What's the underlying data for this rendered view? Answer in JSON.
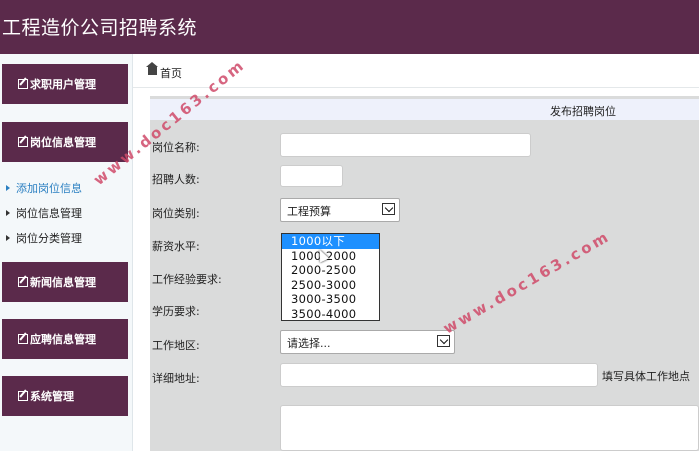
{
  "app": {
    "title": "工程造价公司招聘系统"
  },
  "sidebar": {
    "groups": [
      {
        "label": "求职用户管理"
      },
      {
        "label": "岗位信息管理"
      },
      {
        "label": "新闻信息管理"
      },
      {
        "label": "应聘信息管理"
      },
      {
        "label": "系统管理"
      }
    ],
    "sub_items": [
      {
        "label": "添加岗位信息",
        "active": true
      },
      {
        "label": "岗位信息管理",
        "active": false
      },
      {
        "label": "岗位分类管理",
        "active": false
      }
    ]
  },
  "breadcrumb": {
    "home": "首页"
  },
  "form": {
    "title": "发布招聘岗位",
    "labels": {
      "name": "岗位名称:",
      "count": "招聘人数:",
      "category": "岗位类别:",
      "salary": "薪资水平:",
      "experience": "工作经验要求:",
      "education": "学历要求:",
      "region": "工作地区:",
      "address": "详细地址:"
    },
    "values": {
      "name": "",
      "count": "",
      "category": "工程预算",
      "region": "请选择...",
      "address": ""
    },
    "address_hint": "填写具体工作地点",
    "salary_options": [
      "1000以下",
      "1000-2000",
      "2000-2500",
      "2500-3000",
      "3000-3500",
      "3500-4000"
    ],
    "salary_selected_index": 0
  },
  "watermark": "www.doc163.com",
  "colors": {
    "brand": "#5b2a4b",
    "highlight": "#1e90ff",
    "link": "#2a7fc1"
  }
}
